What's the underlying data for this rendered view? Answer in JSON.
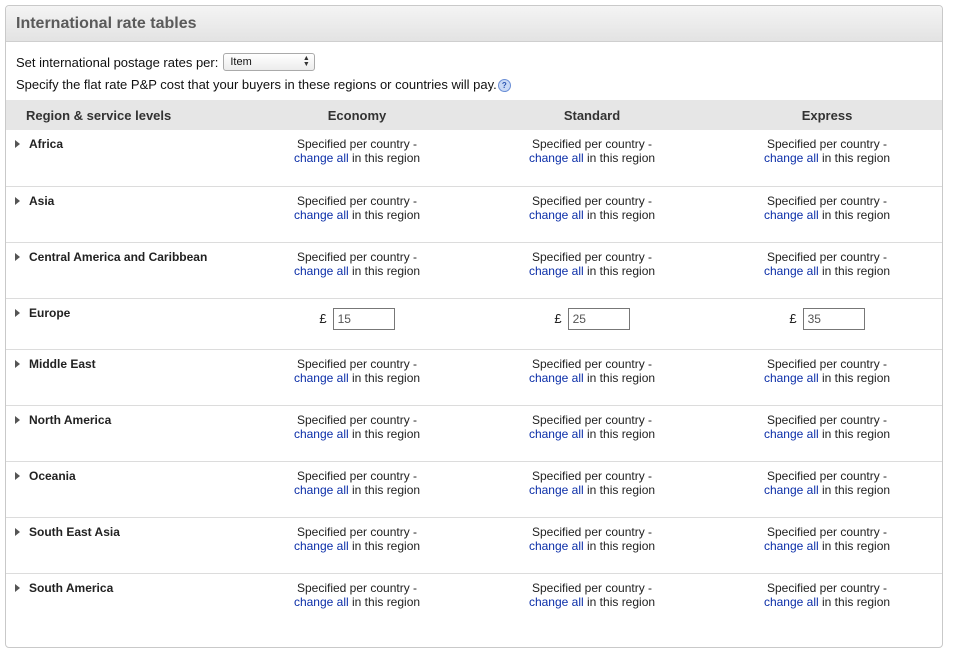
{
  "panel": {
    "title": "International rate tables"
  },
  "settings": {
    "rate_per_label": "Set international postage rates per:",
    "rate_per_value": "Item",
    "description": "Specify the flat rate P&P cost that your buyers in these regions or countries will pay.",
    "help_icon": "?"
  },
  "table": {
    "headers": {
      "region": "Region & service levels",
      "economy": "Economy",
      "standard": "Standard",
      "express": "Express"
    },
    "specified_text": "Specified per country -",
    "change_all_link": "change all",
    "region_suffix": " in this region",
    "currency_symbol": "£",
    "regions": [
      {
        "name": "Africa"
      },
      {
        "name": "Asia"
      },
      {
        "name": "Central America and Caribbean"
      },
      {
        "name": "Europe",
        "economy": "15",
        "standard": "25",
        "express": "35"
      },
      {
        "name": "Middle East"
      },
      {
        "name": "North America"
      },
      {
        "name": "Oceania"
      },
      {
        "name": "South East Asia"
      },
      {
        "name": "South America"
      }
    ]
  },
  "colors": {
    "link": "#0b2ea8",
    "header_bg": "#e6e6e6",
    "title_text": "#5a5a5a"
  }
}
